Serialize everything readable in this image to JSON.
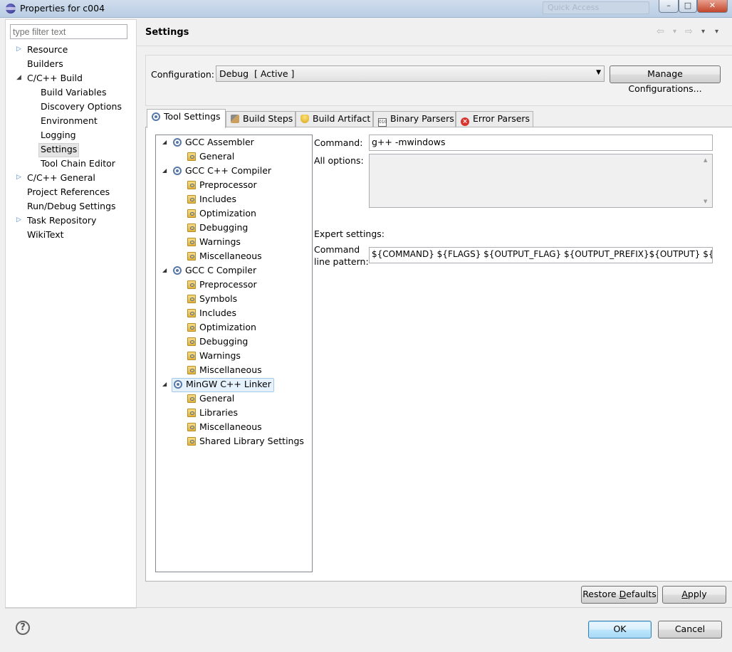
{
  "window": {
    "title": "Properties for c004",
    "quick_access": "Quick Access",
    "minimize": "–",
    "maximize": "□",
    "close": "✕"
  },
  "sidebar": {
    "filter_placeholder": "type filter text",
    "items": [
      {
        "label": "Resource",
        "indent": 0,
        "expander": "▷",
        "selected": false
      },
      {
        "label": "Builders",
        "indent": 0,
        "expander": "",
        "selected": false
      },
      {
        "label": "C/C++ Build",
        "indent": 0,
        "expander": "◢",
        "selected": false
      },
      {
        "label": "Build Variables",
        "indent": 1,
        "expander": "",
        "selected": false
      },
      {
        "label": "Discovery Options",
        "indent": 1,
        "expander": "",
        "selected": false
      },
      {
        "label": "Environment",
        "indent": 1,
        "expander": "",
        "selected": false
      },
      {
        "label": "Logging",
        "indent": 1,
        "expander": "",
        "selected": false
      },
      {
        "label": "Settings",
        "indent": 1,
        "expander": "",
        "selected": true
      },
      {
        "label": "Tool Chain Editor",
        "indent": 1,
        "expander": "",
        "selected": false
      },
      {
        "label": "C/C++ General",
        "indent": 0,
        "expander": "▷",
        "selected": false
      },
      {
        "label": "Project References",
        "indent": 0,
        "expander": "",
        "selected": false
      },
      {
        "label": "Run/Debug Settings",
        "indent": 0,
        "expander": "",
        "selected": false
      },
      {
        "label": "Task Repository",
        "indent": 0,
        "expander": "▷",
        "selected": false
      },
      {
        "label": "WikiText",
        "indent": 0,
        "expander": "",
        "selected": false
      }
    ]
  },
  "header": {
    "title": "Settings",
    "back_icon": "⇦",
    "forward_icon": "⇨",
    "dropdown_icon": "▾"
  },
  "configuration": {
    "label": "Configuration:",
    "value": "Debug  [ Active ]",
    "manage_button": "Manage Configurations..."
  },
  "tabs": [
    {
      "label": "Tool Settings",
      "icon": "gear-icon",
      "active": true
    },
    {
      "label": "Build Steps",
      "icon": "hammer-icon",
      "active": false
    },
    {
      "label": "Build Artifact",
      "icon": "trophy-icon",
      "active": false
    },
    {
      "label": "Binary Parsers",
      "icon": "binary-icon",
      "active": false
    },
    {
      "label": "Error Parsers",
      "icon": "error-icon",
      "active": false
    }
  ],
  "tool_tree": [
    {
      "label": "GCC Assembler",
      "level": 0,
      "icon": "tool-icon",
      "selected": false
    },
    {
      "label": "General",
      "level": 1,
      "icon": "options-folder-icon",
      "selected": false
    },
    {
      "label": "GCC C++ Compiler",
      "level": 0,
      "icon": "tool-icon",
      "selected": false
    },
    {
      "label": "Preprocessor",
      "level": 1,
      "icon": "options-folder-icon",
      "selected": false
    },
    {
      "label": "Includes",
      "level": 1,
      "icon": "options-folder-icon",
      "selected": false
    },
    {
      "label": "Optimization",
      "level": 1,
      "icon": "options-folder-icon",
      "selected": false
    },
    {
      "label": "Debugging",
      "level": 1,
      "icon": "options-folder-icon",
      "selected": false
    },
    {
      "label": "Warnings",
      "level": 1,
      "icon": "options-folder-icon",
      "selected": false
    },
    {
      "label": "Miscellaneous",
      "level": 1,
      "icon": "options-folder-icon",
      "selected": false
    },
    {
      "label": "GCC C Compiler",
      "level": 0,
      "icon": "tool-icon",
      "selected": false
    },
    {
      "label": "Preprocessor",
      "level": 1,
      "icon": "options-folder-icon",
      "selected": false
    },
    {
      "label": "Symbols",
      "level": 1,
      "icon": "options-folder-icon",
      "selected": false
    },
    {
      "label": "Includes",
      "level": 1,
      "icon": "options-folder-icon",
      "selected": false
    },
    {
      "label": "Optimization",
      "level": 1,
      "icon": "options-folder-icon",
      "selected": false
    },
    {
      "label": "Debugging",
      "level": 1,
      "icon": "options-folder-icon",
      "selected": false
    },
    {
      "label": "Warnings",
      "level": 1,
      "icon": "options-folder-icon",
      "selected": false
    },
    {
      "label": "Miscellaneous",
      "level": 1,
      "icon": "options-folder-icon",
      "selected": false
    },
    {
      "label": "MinGW C++ Linker",
      "level": 0,
      "icon": "tool-icon",
      "selected": true
    },
    {
      "label": "General",
      "level": 1,
      "icon": "options-folder-icon",
      "selected": false
    },
    {
      "label": "Libraries",
      "level": 1,
      "icon": "options-folder-icon",
      "selected": false
    },
    {
      "label": "Miscellaneous",
      "level": 1,
      "icon": "options-folder-icon",
      "selected": false
    },
    {
      "label": "Shared Library Settings",
      "level": 1,
      "icon": "options-folder-icon",
      "selected": false
    }
  ],
  "tool_settings": {
    "command_label": "Command:",
    "command_value": "g++ -mwindows",
    "all_options_label": "All options:",
    "all_options_value": "",
    "expert_label": "Expert settings:",
    "pattern_label_1": "Command",
    "pattern_label_2": "line pattern:",
    "pattern_value": "${COMMAND} ${FLAGS} ${OUTPUT_FLAG} ${OUTPUT_PREFIX}${OUTPUT} ${INPUTS}"
  },
  "buttons": {
    "restore_defaults_pre": "Restore ",
    "restore_defaults_u": "D",
    "restore_defaults_post": "efaults",
    "apply_u": "A",
    "apply_post": "pply",
    "ok": "OK",
    "cancel": "Cancel",
    "help": "?"
  }
}
